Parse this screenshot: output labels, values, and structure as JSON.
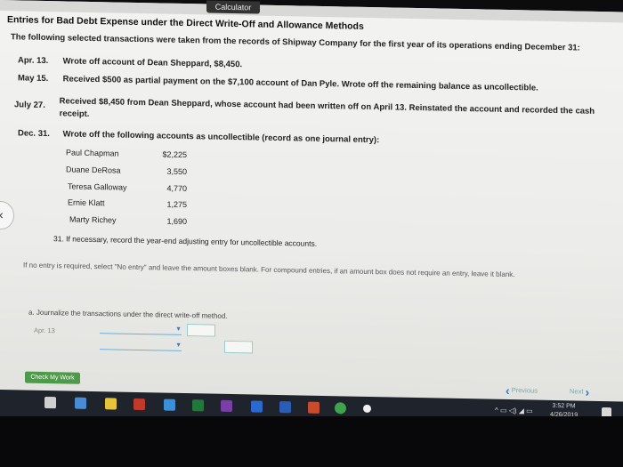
{
  "window": {
    "calculator_tab": "Calculator"
  },
  "heading": "Entries for Bad Debt Expense under the Direct Write-Off and Allowance Methods",
  "intro": "The following selected transactions were taken from the records of Shipway Company for the first year of its operations ending December 31:",
  "transactions": [
    {
      "date": "Apr. 13.",
      "text": "Wrote off account of Dean Sheppard, $8,450."
    },
    {
      "date": "May 15.",
      "text": "Received $500 as partial payment on the $7,100 account of Dan Pyle. Wrote off the remaining balance as uncollectible."
    },
    {
      "date": "July 27.",
      "text": "Received $8,450 from Dean Sheppard, whose account had been written off on April 13. Reinstated the account and recorded the cash",
      "text2": "receipt."
    },
    {
      "date": "Dec. 31.",
      "text": "Wrote off the following accounts as uncollectible (record as one journal entry):"
    }
  ],
  "accounts": [
    {
      "name": "Paul Chapman",
      "amount": "$2,225"
    },
    {
      "name": "Duane DeRosa",
      "amount": "3,550"
    },
    {
      "name": "Teresa Galloway",
      "amount": "4,770"
    },
    {
      "name": "Ernie Klatt",
      "amount": "1,275"
    },
    {
      "name": "Marty Richey",
      "amount": "1,690"
    }
  ],
  "item31": "31.  If necessary, record the year-end adjusting entry for uncollectible accounts.",
  "instructions": "If no entry is required, select \"No entry\" and leave the amount boxes blank. For compound entries, if an amount box does not require an entry, leave it blank.",
  "part_a": "a.  Journalize the transactions under the direct write-off method.",
  "journal": {
    "date_label": "Apr. 13"
  },
  "buttons": {
    "check": "Check My Work",
    "previous": "Previous",
    "next": "Next"
  },
  "taskbar": {
    "time": "3:52 PM",
    "date": "4/26/2019"
  },
  "icons": {
    "left_tab": "chevron-left-icon",
    "previous": "chevron-left-icon",
    "next": "chevron-right-icon",
    "dropdown": "caret-down-icon"
  }
}
